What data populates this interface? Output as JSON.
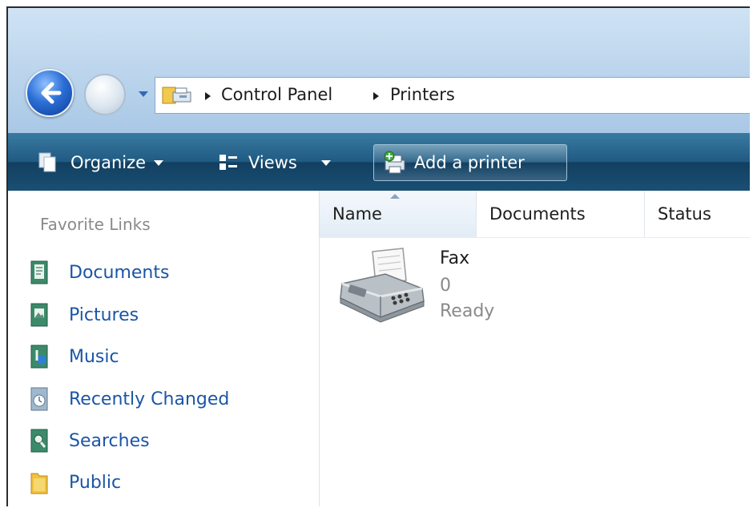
{
  "address_bar": {
    "crumbs": [
      "Control Panel",
      "Printers"
    ]
  },
  "toolbar": {
    "organize_label": "Organize",
    "views_label": "Views",
    "add_printer_label": "Add a printer"
  },
  "sidebar": {
    "title": "Favorite Links",
    "items": [
      {
        "label": "Documents",
        "icon": "documents-icon"
      },
      {
        "label": "Pictures",
        "icon": "pictures-icon"
      },
      {
        "label": "Music",
        "icon": "music-icon"
      },
      {
        "label": "Recently Changed",
        "icon": "recently-changed-icon"
      },
      {
        "label": "Searches",
        "icon": "searches-icon"
      },
      {
        "label": "Public",
        "icon": "public-folder-icon"
      }
    ]
  },
  "columns": [
    "Name",
    "Documents",
    "Status"
  ],
  "items": [
    {
      "name": "Fax",
      "documents": "0",
      "status": "Ready",
      "icon": "fax-printer-icon"
    }
  ],
  "colors": {
    "link": "#1b55a6",
    "toolbar": "#1f5a82",
    "muted_text": "#8a8a8a"
  }
}
